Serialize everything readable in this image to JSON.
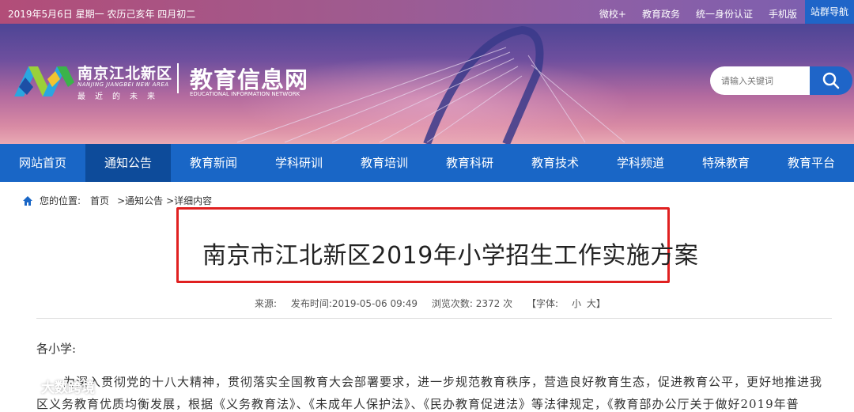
{
  "topbar": {
    "date": "2019年5月6日 星期一 农历己亥年 四月初二",
    "links": [
      "微校+",
      "教育政务",
      "统一身份认证",
      "手机版"
    ],
    "site_nav": "站群导航"
  },
  "banner": {
    "brand_cn": "南京江北新区",
    "brand_en": "NANJING JIANGBEI NEW AREA",
    "brand_slogan": "最近的未来",
    "site_cn": "教育信息网",
    "site_en": "EDUCATIONAL INFORMATION NETWORK",
    "search_placeholder": "请输入关键词"
  },
  "nav": {
    "items": [
      "网站首页",
      "通知公告",
      "教育新闻",
      "学科研训",
      "教育培训",
      "教育科研",
      "教育技术",
      "学科频道",
      "特殊教育",
      "教育平台"
    ],
    "active_index": 1
  },
  "breadcrumb": {
    "label": "您的位置:",
    "items": [
      "首页",
      ">通知公告",
      ">详细内容"
    ]
  },
  "article": {
    "title": "南京市江北新区2019年小学招生工作实施方案",
    "source_label": "来源:",
    "publish_time": "发布时间:2019-05-06 09:49",
    "views": "浏览次数:  2372  次",
    "font_label": "【字体:",
    "font_small": "小",
    "font_large": "大】",
    "greeting": "各小学:",
    "para1": "为深入贯彻党的十八大精神，贯彻落实全国教育大会部署要求，进一步规范教育秩序，营造良好教育生态，促进教育公平，更好地推进我",
    "para2": "区义务教育优质均衡发展，根据《义务教育法》、《未成年人保护法》、《民办教育促进法》等法律规定，《教育部办公厅关于做好2019年普"
  },
  "watermark": "大数跨境",
  "colors": {
    "nav_bg": "#1966c6",
    "nav_active": "#0d4b9a",
    "highlight_border": "#e02020",
    "search_button": "#1f65c8"
  }
}
